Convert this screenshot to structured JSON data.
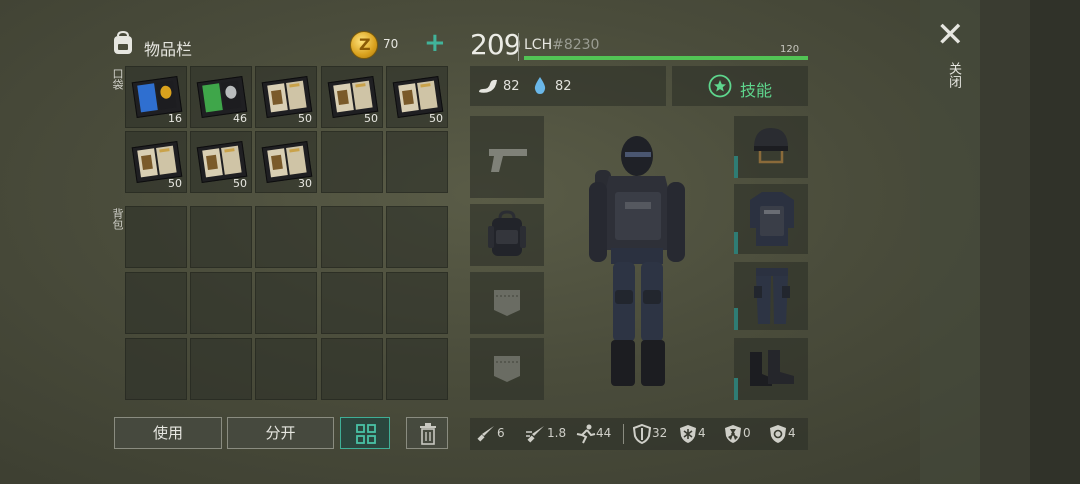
{
  "header": {
    "title": "物品栏",
    "coins": "70",
    "add_symbol": "+"
  },
  "sections": {
    "pocket_label": "口袋",
    "backpack_label": "背包"
  },
  "pocket_items": [
    {
      "qty": "16",
      "icon": "police-id-book-icon",
      "accent": "#2f6fd0"
    },
    {
      "qty": "46",
      "icon": "green-id-book-icon",
      "accent": "#3fa64a"
    },
    {
      "qty": "50",
      "icon": "recipe-book-icon",
      "accent": "#c9a24a"
    },
    {
      "qty": "50",
      "icon": "recipe-book-icon",
      "accent": "#c9a24a"
    },
    {
      "qty": "50",
      "icon": "recipe-book-icon",
      "accent": "#c9a24a"
    },
    {
      "qty": "50",
      "icon": "recipe-book-icon",
      "accent": "#c9a24a"
    },
    {
      "qty": "50",
      "icon": "recipe-book-icon",
      "accent": "#c9a24a"
    },
    {
      "qty": "30",
      "icon": "recipe-book-icon",
      "accent": "#c9a24a"
    }
  ],
  "actions": {
    "use": "使用",
    "split": "分开"
  },
  "player": {
    "level": "209",
    "name": "LCH",
    "tag": "#8230",
    "hp_max": "120",
    "hp_fraction": 1.0,
    "hunger": "82",
    "thirst": "82",
    "skills_label": "技能"
  },
  "equipment": {
    "left": [
      "pistol-slot-icon",
      "backpack-slot-icon",
      "pocket-slot-icon",
      "pocket-slot-icon"
    ],
    "right": [
      "helmet-icon",
      "police-vest-icon",
      "tactical-pants-icon",
      "combat-boots-icon"
    ]
  },
  "bottom_stats": {
    "melee": "6",
    "attack_speed": "1.8",
    "speed": "44",
    "armor": "32",
    "cold": "4",
    "radiation": "0",
    "bio": "4"
  },
  "close_label": "关闭",
  "colors": {
    "accent_teal": "#41b39a",
    "hp_green": "#52c455",
    "skill_green": "#5ed68d"
  }
}
